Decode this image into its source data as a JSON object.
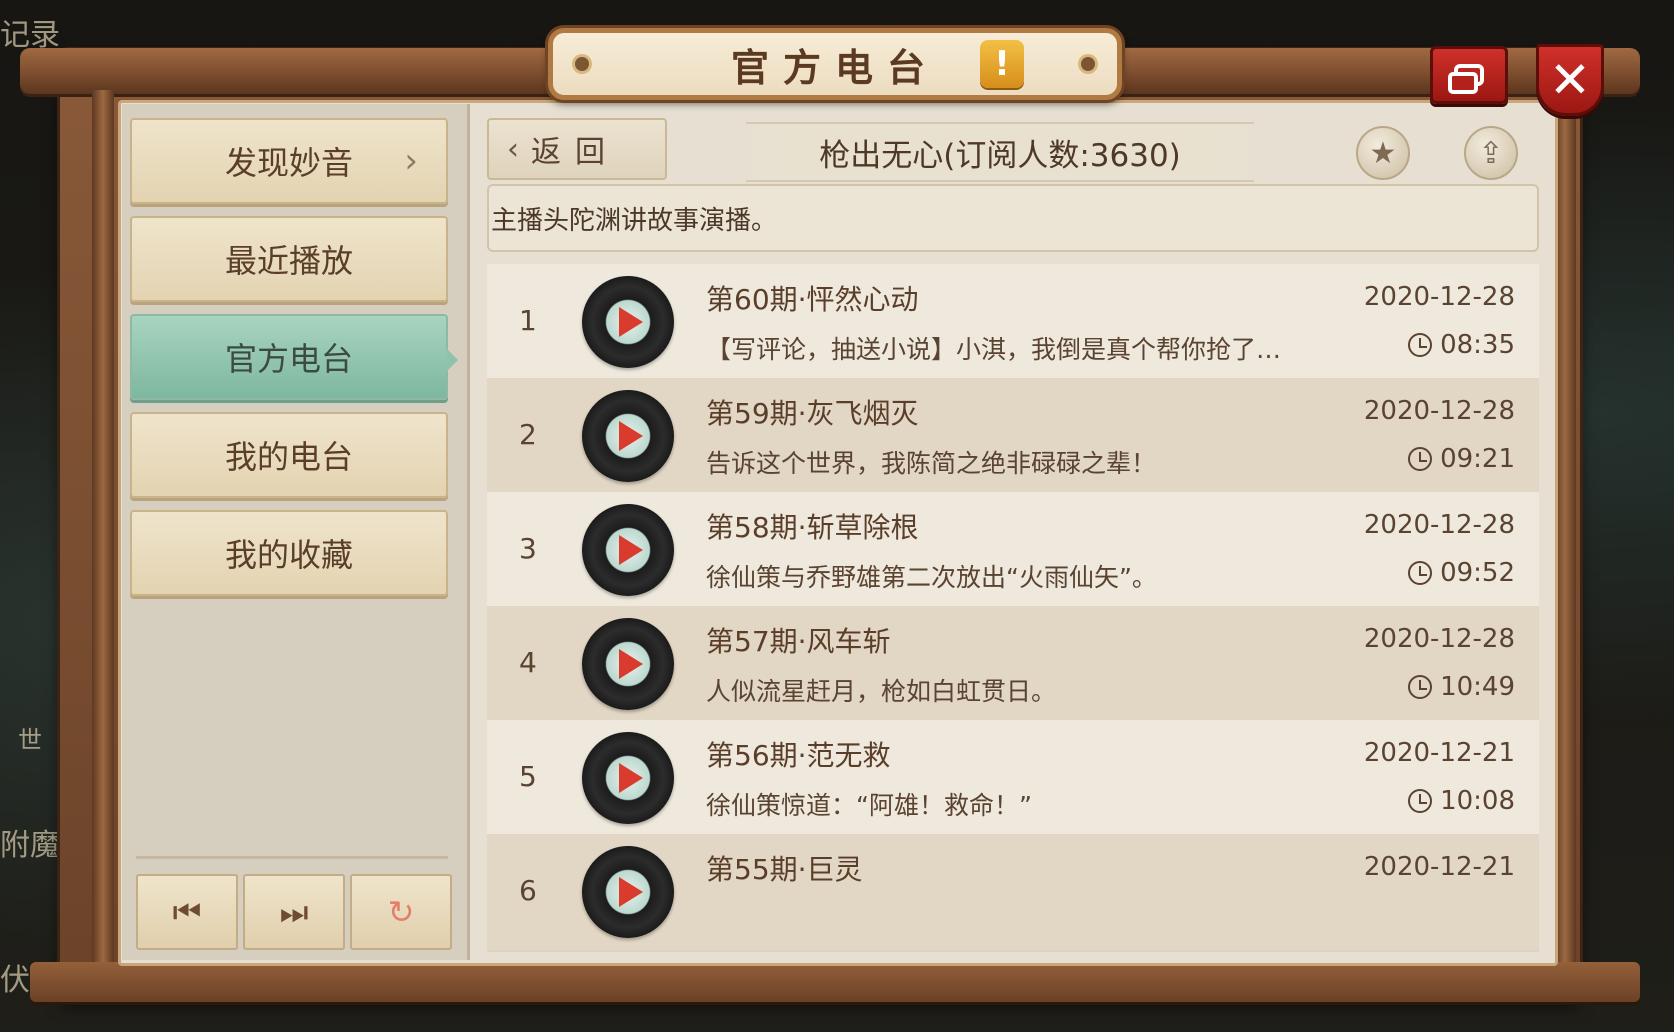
{
  "window": {
    "title": "官方电台",
    "alert_badge": "!",
    "close_label": "✕"
  },
  "background_labels": [
    "记录",
    "附魔",
    "伏魔",
    "世"
  ],
  "nav": {
    "items": [
      {
        "label": "发现妙音",
        "has_arrow": true
      },
      {
        "label": "最近播放"
      },
      {
        "label": "官方电台",
        "active": true
      },
      {
        "label": "我的电台"
      },
      {
        "label": "我的收藏"
      }
    ],
    "arrow_glyph": "›"
  },
  "player": {
    "prev_icon": "⏮",
    "next_icon": "⏭",
    "loop_icon": "↻"
  },
  "header": {
    "back_label": "返回",
    "back_chevron": "‹",
    "channel_title": "枪出无心(订阅人数:3630)",
    "star_icon": "★",
    "share_icon": "⇪"
  },
  "description": "主播头陀渊讲故事演播。",
  "episodes": [
    {
      "index": "1",
      "title": "第60期·怦然心动",
      "subtitle": "【写评论，抽送小说】小淇，我倒是真个帮你抢了…",
      "date": "2020-12-28",
      "duration": "08:35"
    },
    {
      "index": "2",
      "title": "第59期·灰飞烟灭",
      "subtitle": "告诉这个世界，我陈简之绝非碌碌之辈！",
      "date": "2020-12-28",
      "duration": "09:21"
    },
    {
      "index": "3",
      "title": "第58期·斩草除根",
      "subtitle": "徐仙策与乔野雄第二次放出“火雨仙矢”。",
      "date": "2020-12-28",
      "duration": "09:52"
    },
    {
      "index": "4",
      "title": "第57期·风车斩",
      "subtitle": "人似流星赶月，枪如白虹贯日。",
      "date": "2020-12-28",
      "duration": "10:49"
    },
    {
      "index": "5",
      "title": "第56期·范无救",
      "subtitle": "徐仙策惊道：“阿雄！救命！”",
      "date": "2020-12-21",
      "duration": "10:08"
    },
    {
      "index": "6",
      "title": "第55期·巨灵",
      "subtitle": "",
      "date": "2020-12-21",
      "duration": ""
    }
  ],
  "colors": {
    "frame": "#7a4b2c",
    "active_tab": "#8fc3ad",
    "close_red": "#c0251e",
    "alert_gold": "#e6a52e"
  }
}
